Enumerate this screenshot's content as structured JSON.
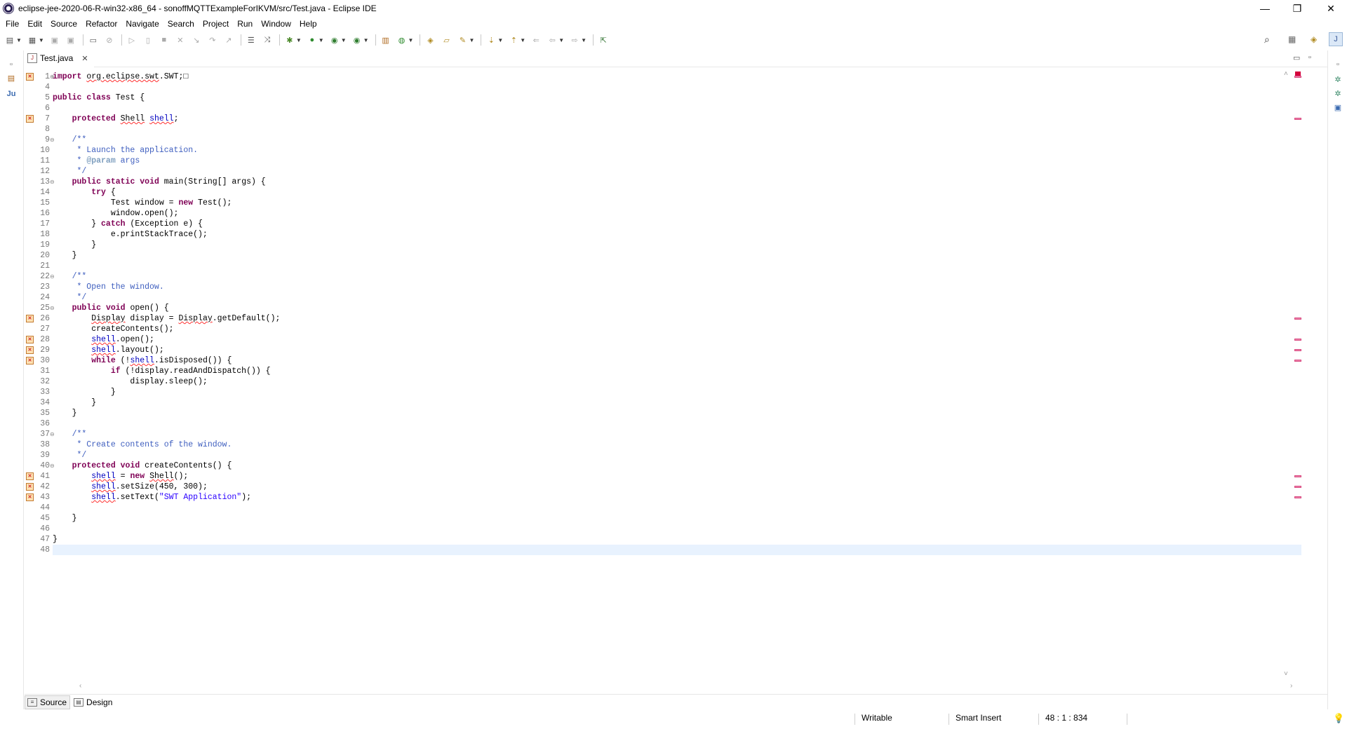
{
  "window": {
    "title": "eclipse-jee-2020-06-R-win32-x86_64 - sonoffMQTTExampleForIKVM/src/Test.java - Eclipse IDE",
    "minimize": "—",
    "restore": "❐",
    "close": "✕"
  },
  "menu": [
    "File",
    "Edit",
    "Source",
    "Refactor",
    "Navigate",
    "Search",
    "Project",
    "Run",
    "Window",
    "Help"
  ],
  "editor": {
    "tab_label": "Test.java",
    "tab_close": "✕",
    "lines": [
      {
        "n": "1",
        "fold": "⊕",
        "marker": true,
        "text": "import org.eclipse.swt.SWT;□"
      },
      {
        "n": "4",
        "text": ""
      },
      {
        "n": "5",
        "text": "public class Test {"
      },
      {
        "n": "6",
        "text": ""
      },
      {
        "n": "7",
        "marker": true,
        "text": "    protected Shell shell;"
      },
      {
        "n": "8",
        "text": ""
      },
      {
        "n": "9",
        "fold": "⊖",
        "text": "    /**"
      },
      {
        "n": "10",
        "text": "     * Launch the application."
      },
      {
        "n": "11",
        "text": "     * @param args"
      },
      {
        "n": "12",
        "text": "     */"
      },
      {
        "n": "13",
        "fold": "⊖",
        "text": "    public static void main(String[] args) {"
      },
      {
        "n": "14",
        "text": "        try {"
      },
      {
        "n": "15",
        "text": "            Test window = new Test();"
      },
      {
        "n": "16",
        "text": "            window.open();"
      },
      {
        "n": "17",
        "text": "        } catch (Exception e) {"
      },
      {
        "n": "18",
        "text": "            e.printStackTrace();"
      },
      {
        "n": "19",
        "text": "        }"
      },
      {
        "n": "20",
        "text": "    }"
      },
      {
        "n": "21",
        "text": ""
      },
      {
        "n": "22",
        "fold": "⊖",
        "text": "    /**"
      },
      {
        "n": "23",
        "text": "     * Open the window."
      },
      {
        "n": "24",
        "text": "     */"
      },
      {
        "n": "25",
        "fold": "⊖",
        "text": "    public void open() {"
      },
      {
        "n": "26",
        "marker": true,
        "text": "        Display display = Display.getDefault();"
      },
      {
        "n": "27",
        "text": "        createContents();"
      },
      {
        "n": "28",
        "marker": true,
        "text": "        shell.open();"
      },
      {
        "n": "29",
        "marker": true,
        "text": "        shell.layout();"
      },
      {
        "n": "30",
        "marker": true,
        "text": "        while (!shell.isDisposed()) {"
      },
      {
        "n": "31",
        "text": "            if (!display.readAndDispatch()) {"
      },
      {
        "n": "32",
        "text": "                display.sleep();"
      },
      {
        "n": "33",
        "text": "            }"
      },
      {
        "n": "34",
        "text": "        }"
      },
      {
        "n": "35",
        "text": "    }"
      },
      {
        "n": "36",
        "text": ""
      },
      {
        "n": "37",
        "fold": "⊖",
        "text": "    /**"
      },
      {
        "n": "38",
        "text": "     * Create contents of the window."
      },
      {
        "n": "39",
        "text": "     */"
      },
      {
        "n": "40",
        "fold": "⊖",
        "text": "    protected void createContents() {"
      },
      {
        "n": "41",
        "marker": true,
        "text": "        shell = new Shell();"
      },
      {
        "n": "42",
        "marker": true,
        "text": "        shell.setSize(450, 300);"
      },
      {
        "n": "43",
        "marker": true,
        "text": "        shell.setText(\"SWT Application\");"
      },
      {
        "n": "44",
        "text": ""
      },
      {
        "n": "45",
        "text": "    }"
      },
      {
        "n": "46",
        "text": ""
      },
      {
        "n": "47",
        "text": "}"
      },
      {
        "n": "48",
        "text": "",
        "current": true
      }
    ],
    "bottom_tabs": [
      {
        "label": "Source",
        "active": true
      },
      {
        "label": "Design",
        "active": false
      }
    ]
  },
  "status": {
    "mode": "Writable",
    "insert": "Smart Insert",
    "position": "48 : 1 : 834"
  },
  "colors": {
    "keyword": "#7f0055",
    "comment": "#3f5fbf",
    "string": "#2a00ff",
    "current_line": "#e8f2fe",
    "error_marker": "#d84a80"
  }
}
